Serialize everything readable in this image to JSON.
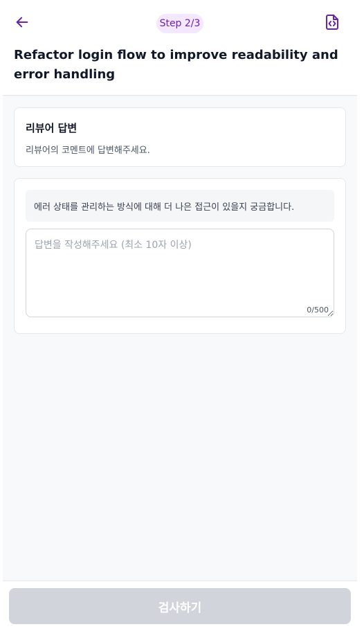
{
  "header": {
    "back_icon": "arrow-left-icon",
    "step_label": "Step 2/3",
    "file_icon": "file-code-icon",
    "title": "Refactor login flow to improve readability and error handling"
  },
  "info_card": {
    "title": "리뷰어 답변",
    "description": "리뷰어의 코멘트에 답변해주세요."
  },
  "answer_card": {
    "comment": "에러 상태를 관리하는 방식에 대해 더 나은 접근이 있을지 궁금합니다.",
    "input_value": "",
    "input_placeholder": "답변을 작성해주세요 (최소 10자 이상)",
    "char_count": "0/500"
  },
  "footer": {
    "submit_label": "검사하기",
    "submit_enabled": false
  },
  "colors": {
    "accent": "#6b21a8",
    "badge_bg": "#f3e8ff",
    "disabled_button": "#d1d5db"
  }
}
